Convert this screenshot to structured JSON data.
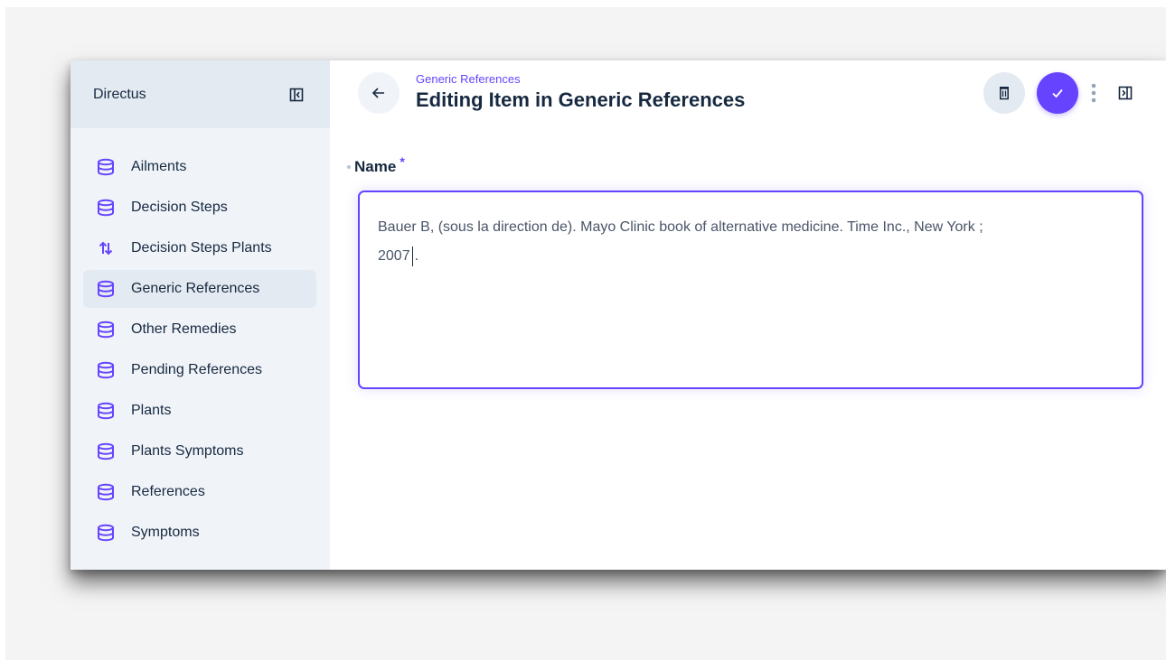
{
  "app": {
    "title": "Directus"
  },
  "colors": {
    "accent": "#6644ff",
    "text": "#172940",
    "sidebar_bg": "#f0f4f9"
  },
  "sidebar": {
    "items": [
      {
        "label": "Ailments",
        "icon": "database-icon",
        "active": false
      },
      {
        "label": "Decision Steps",
        "icon": "database-icon",
        "active": false
      },
      {
        "label": "Decision Steps Plants",
        "icon": "import-export-icon",
        "active": false
      },
      {
        "label": "Generic References",
        "icon": "database-icon",
        "active": true
      },
      {
        "label": "Other Remedies",
        "icon": "database-icon",
        "active": false
      },
      {
        "label": "Pending References",
        "icon": "database-icon",
        "active": false
      },
      {
        "label": "Plants",
        "icon": "database-icon",
        "active": false
      },
      {
        "label": "Plants Symptoms",
        "icon": "database-icon",
        "active": false
      },
      {
        "label": "References",
        "icon": "database-icon",
        "active": false
      },
      {
        "label": "Symptoms",
        "icon": "database-icon",
        "active": false
      }
    ]
  },
  "header": {
    "breadcrumb": "Generic References",
    "title": "Editing Item in Generic References"
  },
  "form": {
    "field_label": "Name",
    "required_marker": "*",
    "value_line1": "Bauer B, (sous la direction de). Mayo Clinic book of alternative medicine. Time Inc., New York ;",
    "value_line2_before_caret": "2007",
    "value_line2_after_caret": "."
  }
}
